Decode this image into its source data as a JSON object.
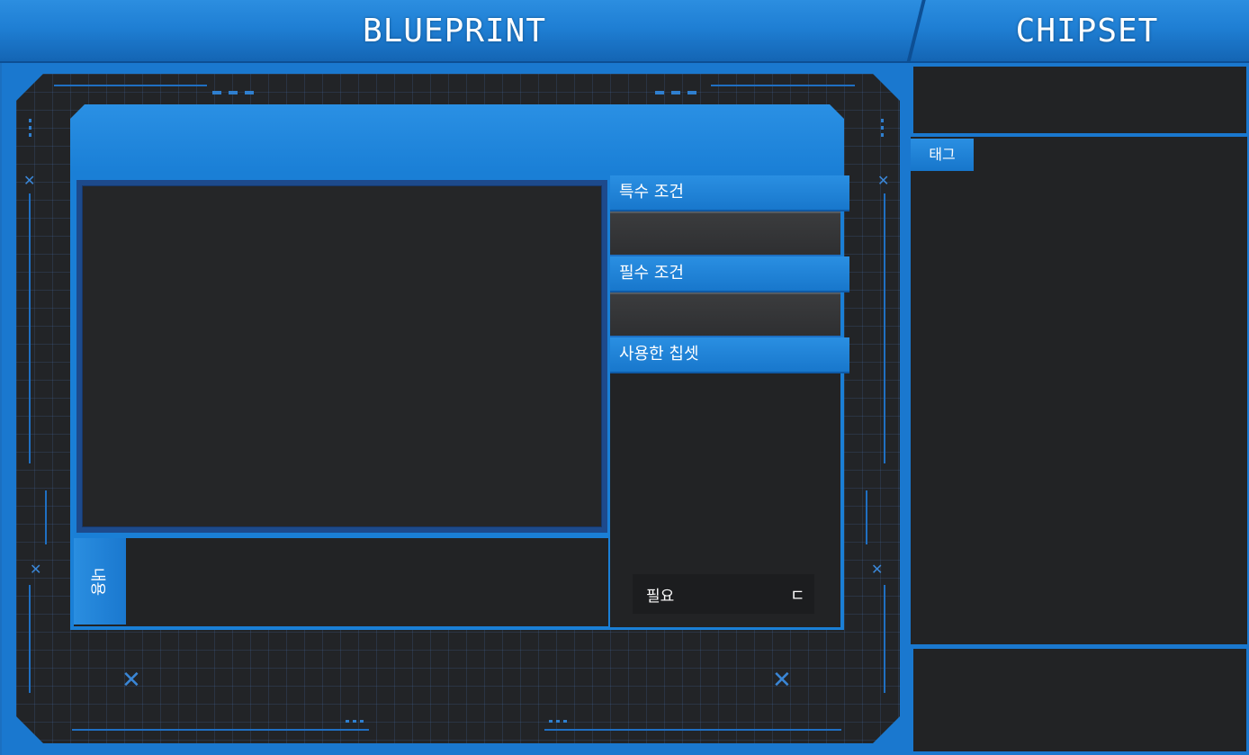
{
  "header": {
    "blueprint_title": "BLUEPRINT",
    "chipset_title": "CHIPSET"
  },
  "blueprint": {
    "special_condition_label": "특수 조건",
    "special_condition_value": "",
    "required_condition_label": "필수 조건",
    "required_condition_value": "",
    "used_chipset_label": "사용한 칩셋",
    "content_tab_label": "내용",
    "content_text": "",
    "required_label": "필요",
    "required_value": "ㄷ"
  },
  "chipset": {
    "tag_tab_label": "태그"
  },
  "colors": {
    "accent_blue": "#1a7fd6",
    "panel_dark": "#222325",
    "grid_bg": "#222427"
  }
}
